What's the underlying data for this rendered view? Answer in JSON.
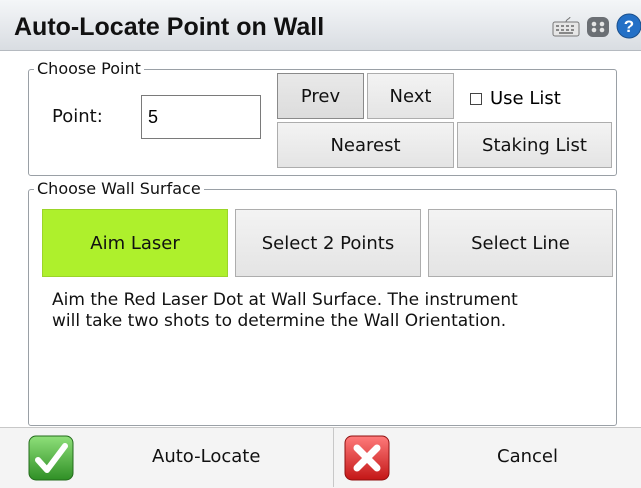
{
  "window": {
    "title": "Auto-Locate Point on Wall",
    "icons": [
      "keyboard-icon",
      "gamepad-icon",
      "help-icon"
    ]
  },
  "choose_point": {
    "legend": "Choose Point",
    "point_label": "Point:",
    "point_value": "5",
    "prev_label": "Prev",
    "next_label": "Next",
    "use_list_label": "Use List",
    "use_list_checked": false,
    "nearest_label": "Nearest",
    "staking_list_label": "Staking List"
  },
  "wall_surface": {
    "legend": "Choose Wall Surface",
    "aim_laser_label": "Aim Laser",
    "select_2_points_label": "Select 2 Points",
    "select_line_label": "Select Line",
    "selected": "Aim Laser",
    "description_line1": "Aim the Red Laser Dot at Wall Surface.  The instrument",
    "description_line2": "will take two shots to determine the Wall Orientation."
  },
  "footer": {
    "auto_locate_label": "Auto-Locate",
    "cancel_label": "Cancel",
    "accept_icon": "green-check-icon",
    "cancel_icon": "red-x-icon"
  },
  "colors": {
    "aim_laser_bg": "#aef02c",
    "title_gradient_top": "#f4f6f8",
    "title_gradient_bottom": "#d9dde2",
    "background_accent": "#ff2d5a"
  }
}
